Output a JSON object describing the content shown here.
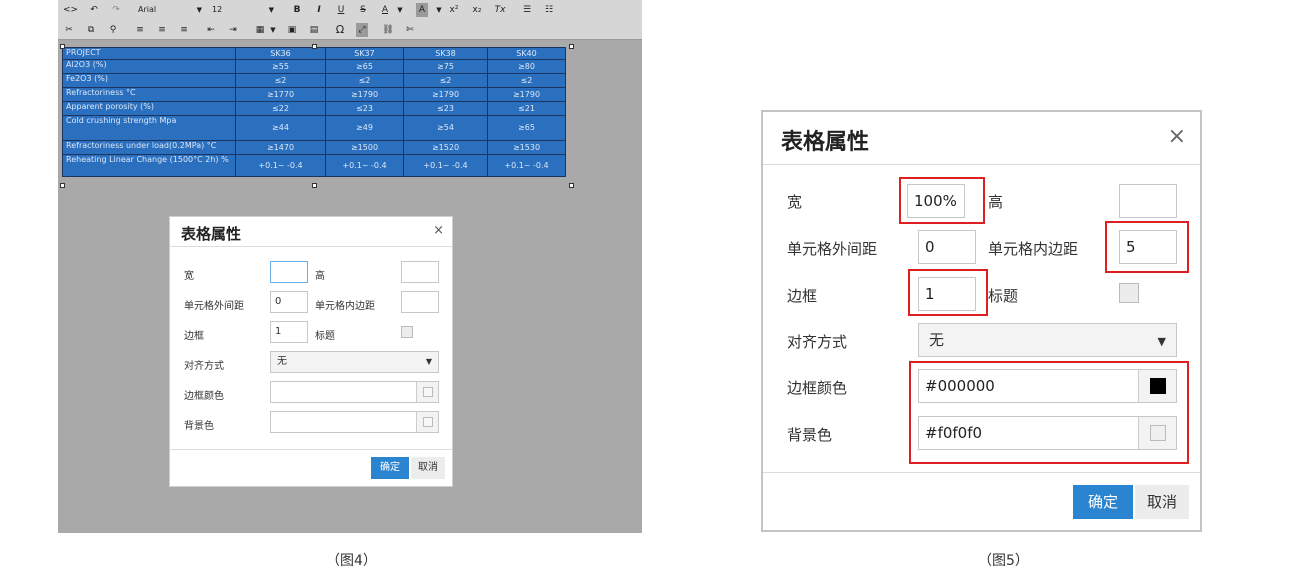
{
  "fig4": {
    "toolbar": {
      "row1": [
        {
          "icon": "source-icon",
          "glyph": "<>"
        },
        {
          "icon": "undo-icon",
          "glyph": "↶"
        },
        {
          "icon": "redo-icon",
          "glyph": "↷"
        },
        {
          "icon": "bold-icon",
          "glyph": "B"
        },
        {
          "icon": "italic-icon",
          "glyph": "I"
        },
        {
          "icon": "underline-icon",
          "glyph": "U"
        },
        {
          "icon": "strikethrough-icon",
          "glyph": "S"
        },
        {
          "icon": "font-color-icon",
          "glyph": "A"
        },
        {
          "icon": "highlight-color-icon",
          "glyph": "A"
        },
        {
          "icon": "superscript-icon",
          "glyph": "x²"
        },
        {
          "icon": "subscript-icon",
          "glyph": "x₂"
        },
        {
          "icon": "clear-format-icon",
          "glyph": "Tx"
        },
        {
          "icon": "bullet-list-icon",
          "glyph": "☰"
        },
        {
          "icon": "numbered-list-icon",
          "glyph": "☷"
        }
      ],
      "font_family": "Arial",
      "font_size": "12",
      "row2": [
        {
          "icon": "cut-icon",
          "glyph": "✂"
        },
        {
          "icon": "copy-icon",
          "glyph": "⧉"
        },
        {
          "icon": "find-icon",
          "glyph": "⚲"
        },
        {
          "icon": "align-left-icon",
          "glyph": "≡"
        },
        {
          "icon": "align-center-icon",
          "glyph": "≡"
        },
        {
          "icon": "align-right-icon",
          "glyph": "≡"
        },
        {
          "icon": "outdent-icon",
          "glyph": "⇤"
        },
        {
          "icon": "indent-icon",
          "glyph": "⇥"
        },
        {
          "icon": "table-icon",
          "glyph": "▦"
        },
        {
          "icon": "image-icon",
          "glyph": "▣"
        },
        {
          "icon": "media-icon",
          "glyph": "▤"
        },
        {
          "icon": "special-char-icon",
          "glyph": "Ω"
        },
        {
          "icon": "fullscreen-icon",
          "glyph": "⤢"
        },
        {
          "icon": "link-icon",
          "glyph": "⛓"
        },
        {
          "icon": "unlink-icon",
          "glyph": "✄"
        }
      ]
    },
    "table": {
      "rows": [
        [
          "PROJECT",
          "SK36",
          "SK37",
          "SK38",
          "SK40"
        ],
        [
          "Al2O3 (%)",
          "≥55",
          "≥65",
          "≥75",
          "≥80"
        ],
        [
          "Fe2O3 (%)",
          "≤2",
          "≤2",
          "≤2",
          "≤2"
        ],
        [
          "Refractoriness °C",
          "≥1770",
          "≥1790",
          "≥1790",
          "≥1790"
        ],
        [
          "Apparent porosity (%)",
          "≤22",
          "≤23",
          "≤23",
          "≤21"
        ],
        [
          "Cold crushing strength Mpa",
          "≥44",
          "≥49",
          "≥54",
          "≥65"
        ],
        [
          "Refractoriness under load(0.2MPa) °C",
          "≥1470",
          "≥1500",
          "≥1520",
          "≥1530"
        ],
        [
          "Reheating Linear Change (1500°C 2h) %",
          "+0.1~ -0.4",
          "+0.1~ -0.4",
          "+0.1~ -0.4",
          "+0.1~ -0.4"
        ]
      ]
    },
    "dialog": {
      "title": "表格属性",
      "close": "×",
      "width_label": "宽",
      "width_value": "",
      "height_label": "高",
      "height_value": "",
      "cellspacing_label": "单元格外间距",
      "cellspacing_value": "0",
      "cellpadding_label": "单元格内边距",
      "cellpadding_value": "",
      "border_label": "边框",
      "border_value": "1",
      "caption_label": "标题",
      "align_label": "对齐方式",
      "align_value": "无",
      "border_color_label": "边框颜色",
      "border_color_value": "",
      "bg_color_label": "背景色",
      "bg_color_value": "",
      "ok": "确定",
      "cancel": "取消"
    },
    "caption": "（图4）"
  },
  "fig5": {
    "dialog": {
      "title": "表格属性",
      "close": "×",
      "width_label": "宽",
      "width_value": "100%",
      "height_label": "高",
      "height_value": "",
      "cellspacing_label": "单元格外间距",
      "cellspacing_value": "0",
      "cellpadding_label": "单元格内边距",
      "cellpadding_value": "5",
      "border_label": "边框",
      "border_value": "1",
      "caption_label": "标题",
      "align_label": "对齐方式",
      "align_value": "无",
      "border_color_label": "边框颜色",
      "border_color_value": "#000000",
      "bg_color_label": "背景色",
      "bg_color_value": "#f0f0f0",
      "ok": "确定",
      "cancel": "取消"
    },
    "caption": "（图5）"
  },
  "colors": {
    "primary_button": "#2b84cf",
    "highlight_box": "#e02020",
    "selection": "#2b6fbf",
    "border_swatch": "#000000",
    "background_swatch": "#f0f0f0"
  }
}
